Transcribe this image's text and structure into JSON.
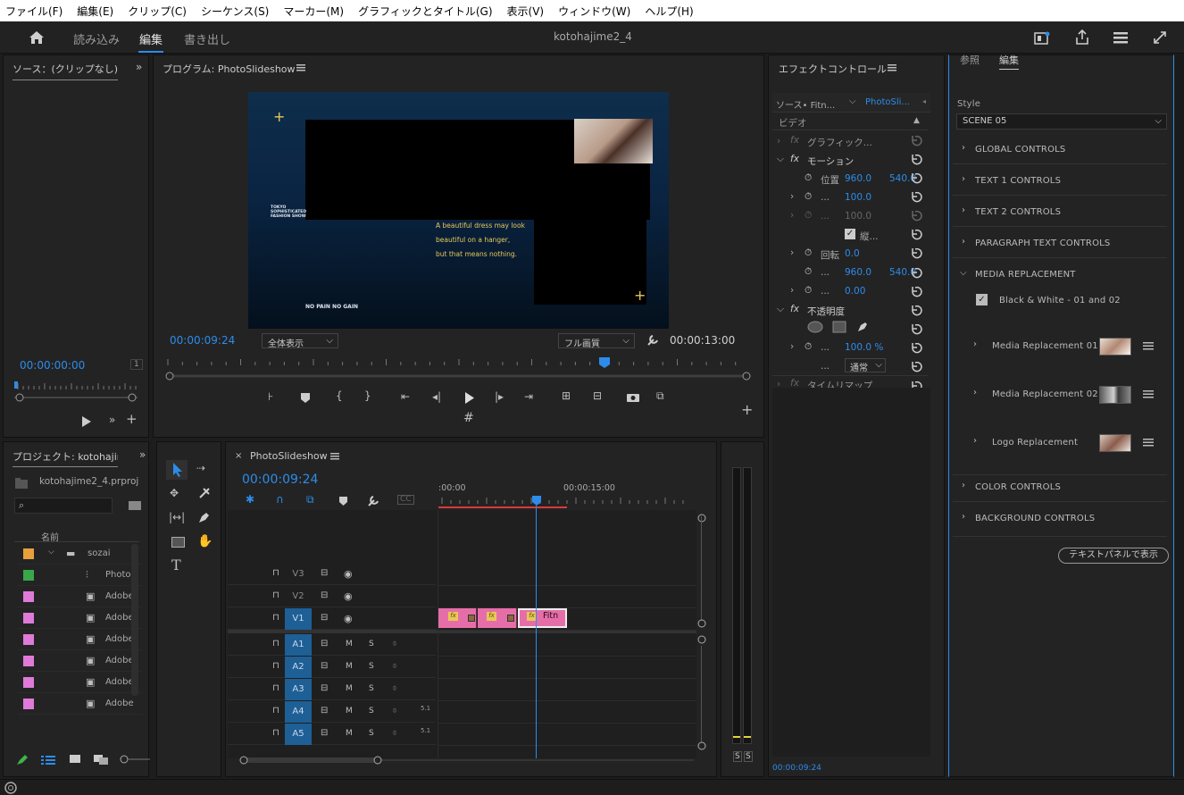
{
  "menu": [
    "ファイル(F)",
    "編集(E)",
    "クリップ(C)",
    "シーケンス(S)",
    "マーカー(M)",
    "グラフィックとタイトル(G)",
    "表示(V)",
    "ウィンドウ(W)",
    "ヘルプ(H)"
  ],
  "workspace": {
    "tabs": [
      "読み込み",
      "編集",
      "書き出し"
    ],
    "active": "編集",
    "project_title": "kotohajime2_4"
  },
  "source": {
    "title": "ソース：(クリップなし)",
    "timecode": "00:00:00:00",
    "scale": "1"
  },
  "program": {
    "title": "プログラム: PhotoSlideshow",
    "timecode": "00:00:09:24",
    "zoom": "全体表示",
    "quality": "フル画質",
    "duration": "00:00:13:00",
    "frame": {
      "brand_lines": [
        "TOKYO",
        "SOPHISTICATED",
        "FASHION SHOW"
      ],
      "quote_lines": [
        "A beautiful dress may look",
        "beautiful on a hanger,",
        "but that means nothing."
      ],
      "footer": "NO PAIN NO GAIN"
    }
  },
  "effects": {
    "title": "エフェクトコントロール",
    "src_tab": "ソース• Fitn...",
    "seq_tab": "PhotoSli...",
    "section": "ビデオ",
    "rows": {
      "graphic": "グラフィック...",
      "motion": "モーション",
      "position_label": "位置",
      "position_x": "960.0",
      "position_y": "540.0",
      "scale_label": "...",
      "scale": "100.0",
      "scale_w_label": "...",
      "scale_w": "100.0",
      "uniform_label": "縦...",
      "rotation_label": "回転",
      "rotation": "0.0",
      "anchor_label": "...",
      "anchor_x": "960.0",
      "anchor_y": "540.0",
      "flicker_label": "...",
      "flicker": "0.00",
      "opacity": "不透明度",
      "opacity_label": "...",
      "opacity_value": "100.0 %",
      "blend_label": "...",
      "blend": "通常",
      "timeremap": "タイムリマップ"
    },
    "footer_time": "00:00:09:24"
  },
  "essential": {
    "tabs": [
      "参照",
      "編集"
    ],
    "style_label": "Style",
    "style_value": "SCENE 05",
    "sections": [
      "GLOBAL CONTROLS",
      "TEXT 1 CONTROLS",
      "TEXT 2 CONTROLS",
      "PARAGRAPH TEXT CONTROLS",
      "MEDIA REPLACEMENT",
      "COLOR CONTROLS",
      "BACKGROUND CONTROLS"
    ],
    "bw_checkbox": "Black & White - 01 and 02",
    "media_items": [
      "Media Replacement 01",
      "Media Replacement 02",
      "Logo Replacement"
    ],
    "text_panel_button": "テキストパネルで表示"
  },
  "project": {
    "title": "プロジェクト: kotohajim",
    "file": "kotohajime2_4.prproj",
    "col_name": "名前",
    "items": [
      {
        "name": "sozai",
        "color": "#e8a03c"
      },
      {
        "name": "Photo",
        "color": "#3aa64a"
      },
      {
        "name": "Adobe",
        "color": "#e07ad8"
      },
      {
        "name": "Adobe",
        "color": "#e07ad8"
      },
      {
        "name": "Adobe",
        "color": "#e07ad8"
      },
      {
        "name": "Adobe",
        "color": "#e07ad8"
      },
      {
        "name": "Adobe",
        "color": "#e07ad8"
      },
      {
        "name": "Adobe",
        "color": "#e07ad8"
      }
    ]
  },
  "timeline": {
    "tab": "PhotoSlideshow",
    "timecode": "00:00:09:24",
    "ruler": [
      ":00:00",
      "00:00:15:00"
    ],
    "video_tracks": [
      "V3",
      "V2",
      "V1"
    ],
    "audio_tracks": [
      "A1",
      "A2",
      "A3",
      "A4",
      "A5"
    ],
    "audio_channels": "5.1",
    "clip_label": "Fitn",
    "fx": "fx",
    "meter_labels": [
      "S",
      "S"
    ]
  },
  "colors": {
    "accent": "#2d8ceb",
    "clip": "#e66ea8",
    "playhead": "#2d8ceb",
    "in_out": "#d93a3a"
  }
}
